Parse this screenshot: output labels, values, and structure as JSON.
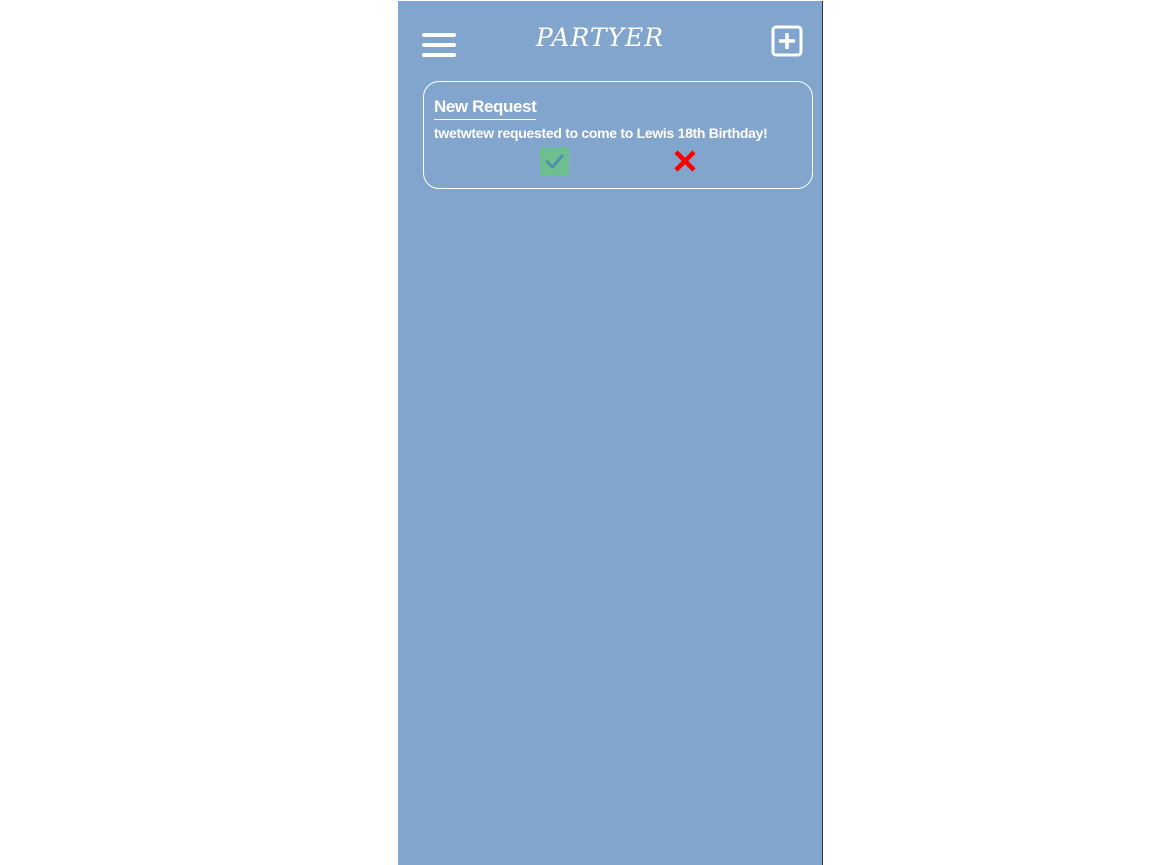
{
  "app": {
    "title": "PARTYER"
  },
  "header": {
    "menu_icon": "hamburger-menu-icon",
    "add_icon": "plus-square-icon"
  },
  "request_card": {
    "title": "New Request",
    "message": "twetwtew requested to come to Lewis 18th Birthday!",
    "accept_icon": "check-icon",
    "decline_icon": "close-icon"
  },
  "colors": {
    "background": "#81a5cd",
    "text": "#ffffff",
    "accept": "#6dbf8f",
    "accept_check": "#4f8fb0",
    "decline": "#ff0000"
  }
}
